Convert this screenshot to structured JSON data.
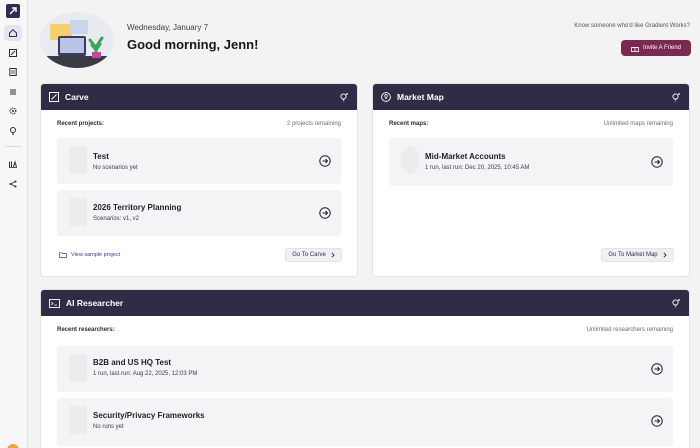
{
  "header": {
    "date": "Wednesday, January 7",
    "greeting": "Good morning, Jenn!",
    "refer_text": "Know someone who'd like Gradient Works?",
    "invite_label": "Invite A Friend"
  },
  "colors": {
    "header_bg": "#2f2c46",
    "invite_bg": "#7a2a52",
    "accent_link": "#3a3a8c"
  },
  "sidebar": {
    "items": [
      {
        "name": "home",
        "icon": "home-icon",
        "active": true
      },
      {
        "name": "carve",
        "icon": "edit-square-icon"
      },
      {
        "name": "documents",
        "icon": "document-icon"
      },
      {
        "name": "list",
        "icon": "list-icon"
      },
      {
        "name": "settings",
        "icon": "gear-icon"
      },
      {
        "name": "ideas",
        "icon": "lightbulb-icon"
      },
      {
        "name": "library",
        "icon": "library-icon"
      },
      {
        "name": "share",
        "icon": "share-icon"
      }
    ]
  },
  "carve": {
    "title": "Carve",
    "label": "Recent projects:",
    "remaining": "2 projects remaining",
    "items": [
      {
        "name": "Test",
        "sub": "No scenarios yet"
      },
      {
        "name": "2026 Territory Planning",
        "sub": "Scenarios: v1, v2"
      }
    ],
    "link": "View sample project",
    "button": "Go To Carve"
  },
  "market_map": {
    "title": "Market Map",
    "label": "Recent maps:",
    "remaining": "Unlimited maps remaining",
    "items": [
      {
        "name": "Mid-Market Accounts",
        "sub": "1 run, last run: Dec 20, 2025, 10:45 AM"
      }
    ],
    "button": "Go To Market Map"
  },
  "researcher": {
    "title": "AI Researcher",
    "label": "Recent researchers:",
    "remaining": "Unlimited researchers remaining",
    "items": [
      {
        "name": "B2B and US HQ Test",
        "sub": "1 run, last run: Aug 22, 2025, 12:03 PM"
      },
      {
        "name": "Security/Privacy Frameworks",
        "sub": "No runs yet"
      }
    ]
  }
}
